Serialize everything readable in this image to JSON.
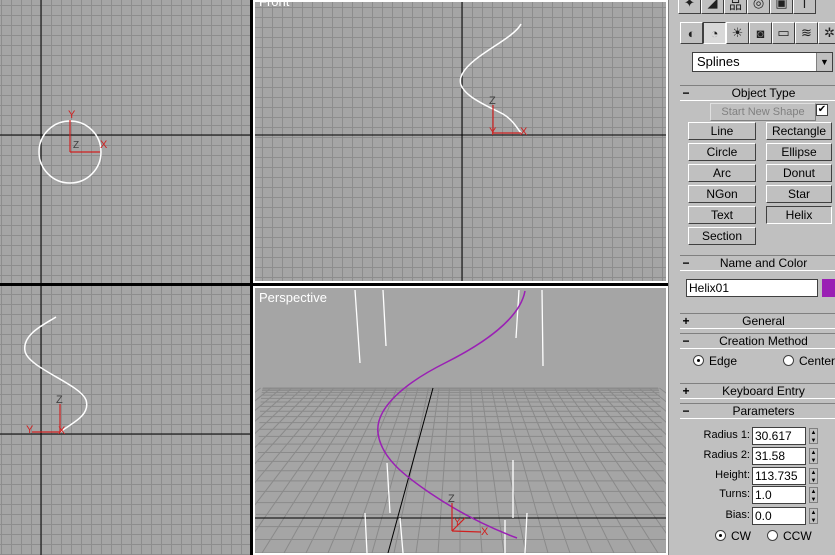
{
  "viewports": {
    "top": {
      "label": ""
    },
    "front": {
      "label": "Front"
    },
    "left": {
      "label": ""
    },
    "perspective": {
      "label": "Perspective"
    }
  },
  "axis_labels": {
    "x": "X",
    "y": "Y",
    "z": "Z"
  },
  "toolbar": {
    "row1": [
      "lightning-icon",
      "hierarchy-icon",
      "motion-icon",
      "display-icon",
      "utilities-icon"
    ],
    "row2": [
      "geometry-icon",
      "shapes-icon",
      "lights-icon",
      "cameras-icon",
      "helpers-icon",
      "spacewarps-icon",
      "systems-icon"
    ]
  },
  "category_dropdown": {
    "value": "Splines"
  },
  "object_type": {
    "title": "Object Type",
    "start_new_shape": "Start New Shape",
    "start_new_shape_checked": true,
    "buttons": [
      "Line",
      "Rectangle",
      "Circle",
      "Ellipse",
      "Arc",
      "Donut",
      "NGon",
      "Star",
      "Text",
      "Helix",
      "Section"
    ]
  },
  "name_color": {
    "title": "Name and Color",
    "name": "Helix01",
    "color": "#9a20b4"
  },
  "general": {
    "title": "General"
  },
  "creation_method": {
    "title": "Creation Method",
    "options": [
      "Edge",
      "Center"
    ],
    "selected": "Edge"
  },
  "keyboard_entry": {
    "title": "Keyboard Entry"
  },
  "parameters": {
    "title": "Parameters",
    "radius1_label": "Radius 1:",
    "radius1": "30.617",
    "radius2_label": "Radius 2:",
    "radius2": "31.58",
    "height_label": "Height:",
    "height": "113.735",
    "turns_label": "Turns:",
    "turns": "1.0",
    "bias_label": "Bias:",
    "bias": "0.0",
    "direction": [
      "CW",
      "CCW"
    ],
    "direction_selected": "CW"
  },
  "colors": {
    "viewport_bg": "#a5a5a5",
    "grid": "#8d8d8d",
    "axis_red": "#d02020",
    "helix": "#9a20b4"
  }
}
